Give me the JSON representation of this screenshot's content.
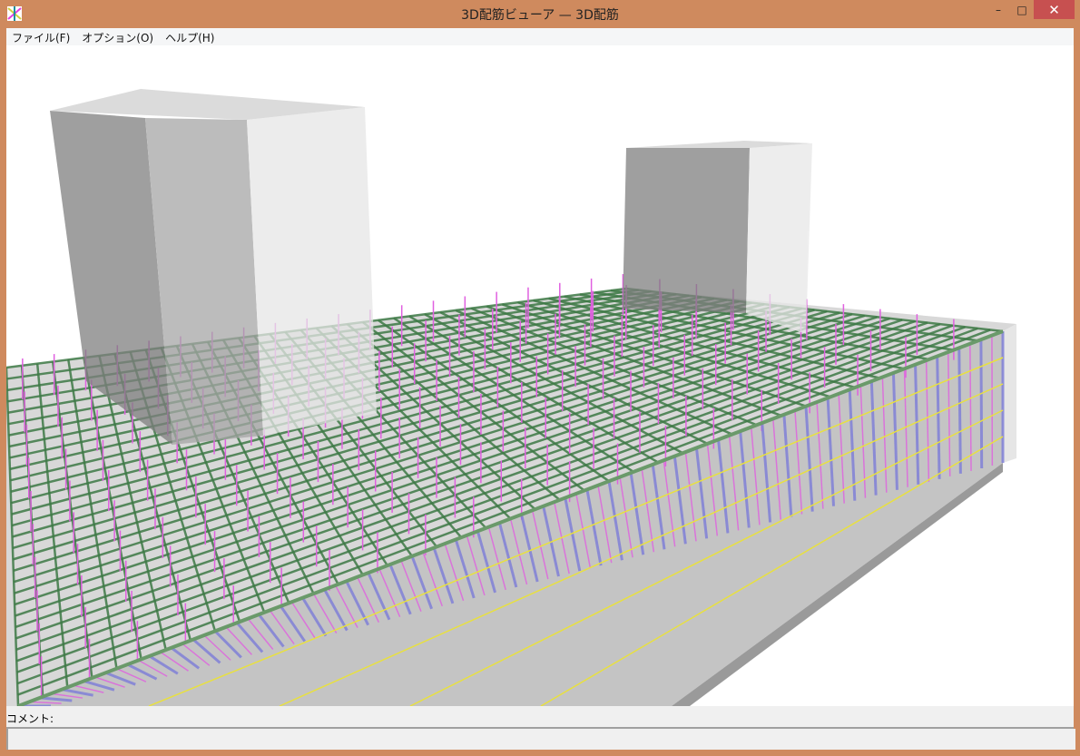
{
  "window": {
    "title": "3D配筋ビューア — 3D配筋",
    "minimize": "–",
    "maximize": "□",
    "close": "✕"
  },
  "menu": [
    {
      "label": "ファイル(F)"
    },
    {
      "label": "オプション(O)"
    },
    {
      "label": "ヘルプ(H)"
    }
  ],
  "comment": {
    "label": "コメント:"
  },
  "colors": {
    "frame": "#CF8A5E",
    "rebar_top": "#3E7A46",
    "stirrup": "#E060E0",
    "main_bar": "#7C7CD8",
    "yellow_bar": "#E8E040"
  }
}
